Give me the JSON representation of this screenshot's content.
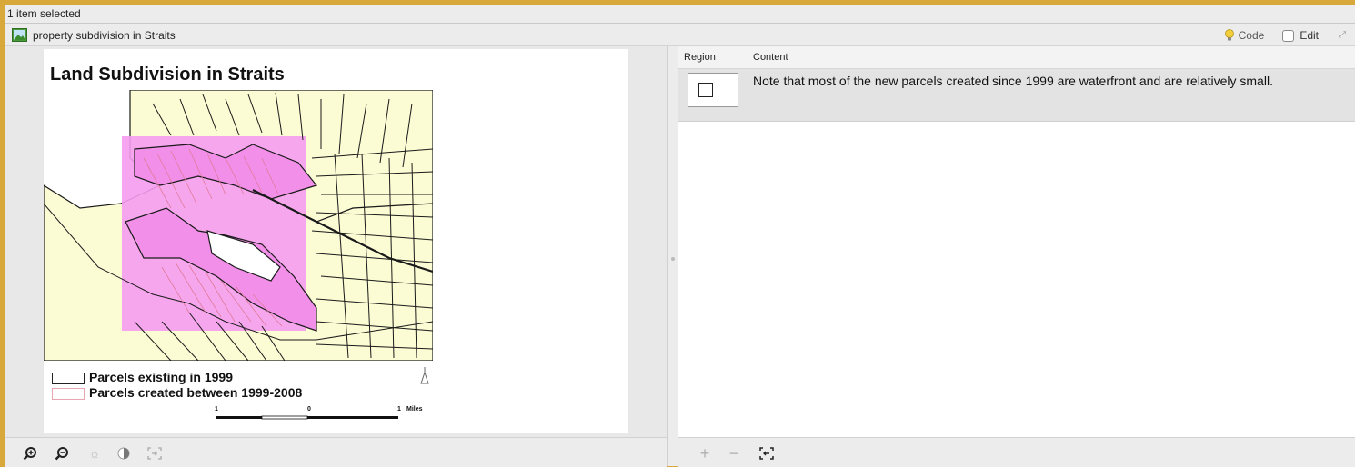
{
  "status": {
    "selection_text": "1 item selected"
  },
  "doc": {
    "name": "property subdivision in Straits"
  },
  "toolbar": {
    "code_label": "Code",
    "edit_label": "Edit"
  },
  "map": {
    "title": "Land Subdivision in Straits",
    "legend": [
      {
        "label": "Parcels existing in 1999",
        "color": "#222222"
      },
      {
        "label": "Parcels created between 1999-2008",
        "color": "#e8a6b0"
      }
    ],
    "scale": {
      "left": "1",
      "middle": "0",
      "right": "1",
      "unit": "Miles"
    },
    "colors": {
      "land": "#fbfbd4",
      "highlight": "#f59cf0",
      "parcel_line": "#1a1a1a",
      "new_parcel_line": "#e07a9a"
    }
  },
  "table": {
    "columns": [
      "Region",
      "Content"
    ],
    "rows": [
      {
        "content": "Note that most of the new parcels created since 1999 are waterfront and are relatively small."
      }
    ]
  },
  "left_tools": [
    "zoom-in-icon",
    "zoom-out-icon",
    "brightness-icon",
    "contrast-icon",
    "fit-icon"
  ],
  "right_tools": [
    "add-icon",
    "remove-icon",
    "select-region-icon"
  ]
}
